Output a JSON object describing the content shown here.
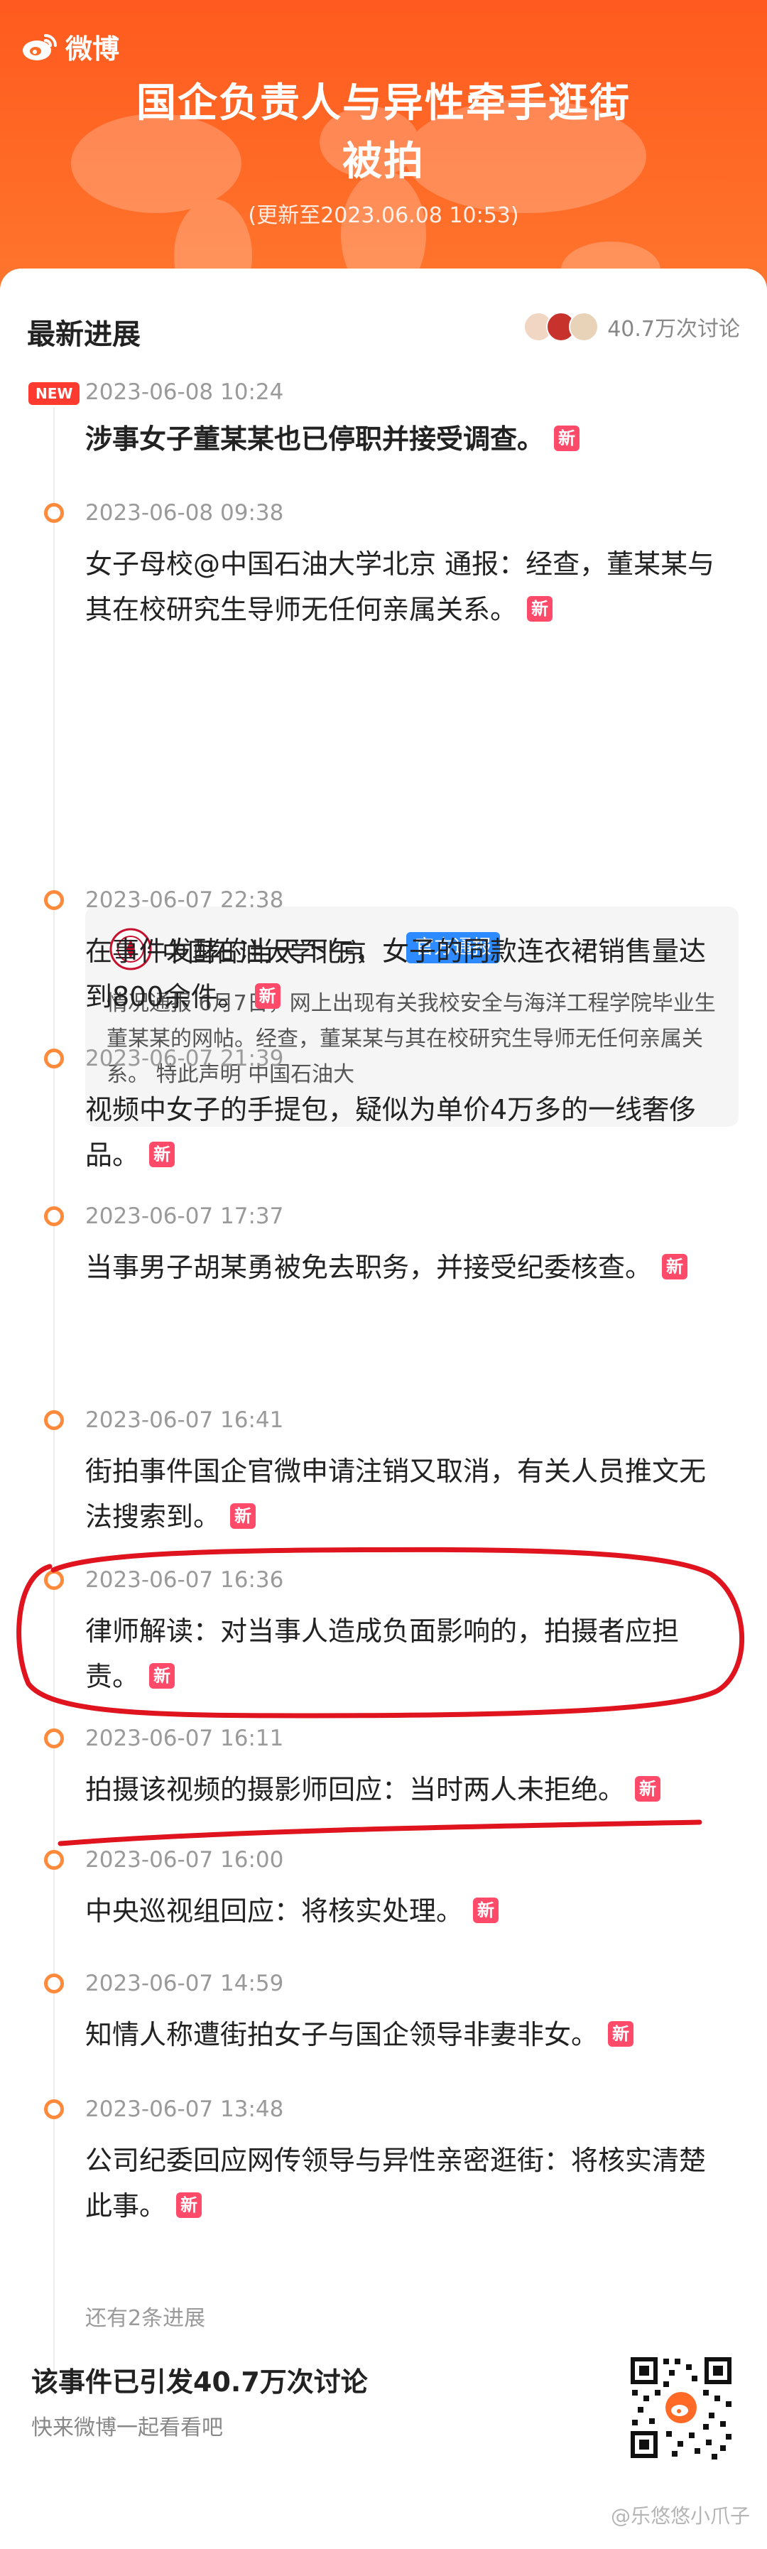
{
  "header": {
    "brand": "微博",
    "title_line1": "国企负责人与异性牵手逛街",
    "title_line2": "被拍",
    "updated": "(更新至2023.06.08 10:53)"
  },
  "section": {
    "title": "最新进展",
    "discussion_count": "40.7万次讨论"
  },
  "new_badge": "NEW",
  "xin_badge": "新",
  "timeline": [
    {
      "time": "2023-06-08 10:24",
      "text": "涉事女子董某某也已停职并接受调查。",
      "is_new": true
    },
    {
      "time": "2023-06-08 09:38",
      "text": "女子母校@中国石油大学北京 通报：经查，董某某与其在校研究生导师无任何亲属关系。"
    },
    {
      "time": "2023-06-07 22:38",
      "text": "在事件发酵的当天下午，女子的同款连衣裙销售量达到800余件。"
    },
    {
      "time": "2023-06-07 21:39",
      "text": "视频中女子的手提包，疑似为单价4万多的一线奢侈品。"
    },
    {
      "time": "2023-06-07 17:37",
      "text": "当事男子胡某勇被免去职务，并接受纪委核查。"
    },
    {
      "time": "2023-06-07 16:41",
      "text": "街拍事件国企官微申请注销又取消，有关人员推文无法搜索到。"
    },
    {
      "time": "2023-06-07 16:36",
      "text": "律师解读：对当事人造成负面影响的，拍摄者应担责。"
    },
    {
      "time": "2023-06-07 16:11",
      "text": "拍摄该视频的摄影师回应：当时两人未拒绝。"
    },
    {
      "time": "2023-06-07 16:00",
      "text": "中央巡视组回应：将核实处理。"
    },
    {
      "time": "2023-06-07 14:59",
      "text": "知情人称遭街拍女子与国企领导非妻非女。"
    },
    {
      "time": "2023-06-07 13:48",
      "text": "公司纪委回应网传领导与异性亲密逛街：将核实清楚此事。"
    }
  ],
  "official_card": {
    "name": "中国石油大学北京",
    "badge": "官方通报",
    "text": "情况通报 6月7日，网上出现有关我校安全与海洋工程学院毕业生董某某的网帖。经查，董某某与其在校研究生导师无任何亲属关系。 特此声明 中国石油大"
  },
  "more_progress": "还有2条进展",
  "footer": {
    "title": "该事件已引发40.7万次讨论",
    "subtitle": "快来微博一起看看吧"
  },
  "watermark": "@乐悠悠小爪子",
  "colors": {
    "header_orange": "#ff6a26",
    "dot_orange": "#ff8a3c",
    "new_red": "#ff3b30",
    "xin_pink": "#ff4a6a",
    "badge_blue": "#2e8bff",
    "annotation_red": "#e0141e"
  }
}
